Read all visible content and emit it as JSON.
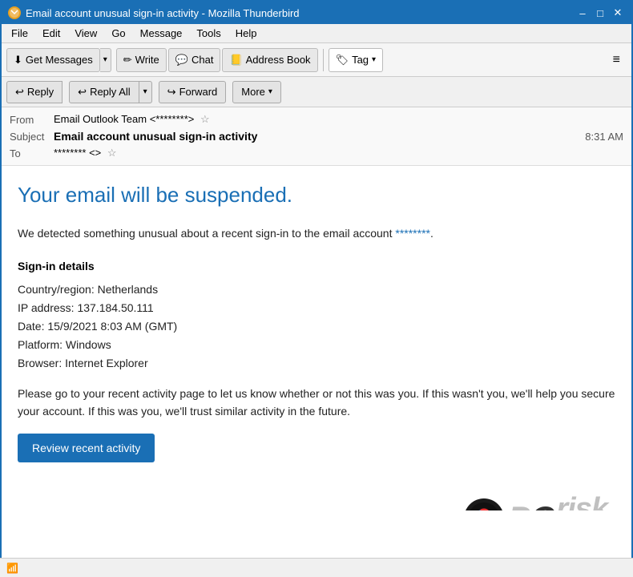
{
  "window": {
    "title": "Email account unusual sign-in activity - Mozilla Thunderbird",
    "icon": "TB",
    "controls": [
      "–",
      "□",
      "✕"
    ]
  },
  "menubar": {
    "items": [
      "File",
      "Edit",
      "View",
      "Go",
      "Message",
      "Tools",
      "Help"
    ]
  },
  "toolbar": {
    "get_messages_label": "Get Messages",
    "write_label": "Write",
    "chat_label": "Chat",
    "address_book_label": "Address Book",
    "tag_label": "Tag",
    "hamburger": "≡"
  },
  "email_actions": {
    "reply_label": "Reply",
    "reply_all_label": "Reply All",
    "forward_label": "Forward",
    "more_label": "More"
  },
  "email_header": {
    "from_label": "From",
    "from_value": "Email Outlook Team <********>",
    "subject_label": "Subject",
    "subject_value": "Email account unusual sign-in activity",
    "to_label": "To",
    "to_value": "******** <>",
    "time": "8:31 AM"
  },
  "email_body": {
    "headline": "Your email will be suspended.",
    "intro": "We detected something unusual about a recent sign-in to the email account ********.",
    "signin_title": "Sign-in details",
    "signin_items": [
      "Country/region: Netherlands",
      "IP address: 137.184.50.111",
      "Date: 15/9/2021 8:03 AM (GMT)",
      "Platform: Windows",
      "Browser: Internet Explorer"
    ],
    "body_text": "Please go to your recent activity page to let us know whether or not this was you. If this wasn't you, we'll help you secure your account. If this was you, we'll trust similar activity in the future.",
    "review_btn_label": "Review recent activity",
    "pcrisk": "PCrisk.com"
  },
  "statusbar": {
    "wifi_icon": "📶",
    "text": ""
  },
  "colors": {
    "accent_blue": "#1a6fb5",
    "light_bg": "#f0f0f0"
  }
}
